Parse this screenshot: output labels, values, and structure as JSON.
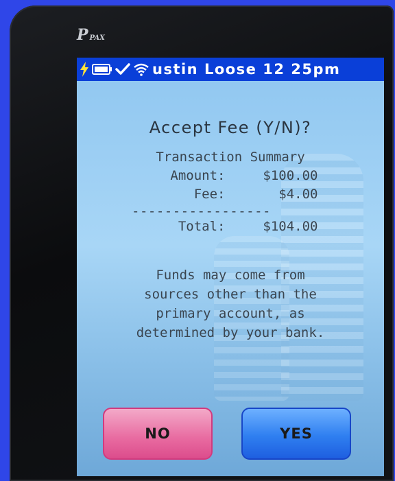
{
  "brand": {
    "logo_text": "P",
    "logo_sub": "PAX"
  },
  "status_bar": {
    "icons": [
      "lightning-icon",
      "battery-icon",
      "check-icon",
      "wifi-icon"
    ],
    "title": "ustin Loose 12 25pm"
  },
  "prompt": {
    "heading": "Accept Fee (Y/N)?",
    "summary_title": "Transaction Summary",
    "amount_label": "Amount:",
    "amount_value": "$100.00",
    "fee_label": "Fee:",
    "fee_value": "$4.00",
    "divider": "-----------------",
    "total_label": "Total:",
    "total_value": "$104.00",
    "notice_lines": [
      "Funds may come from",
      "sources other than the",
      "primary account, as",
      "determined by your bank."
    ]
  },
  "buttons": {
    "no_label": "NO",
    "yes_label": "YES"
  },
  "colors": {
    "status_bar": "#0a3fd8",
    "no_button": "#e86aa0",
    "yes_button": "#2f7ff0"
  }
}
